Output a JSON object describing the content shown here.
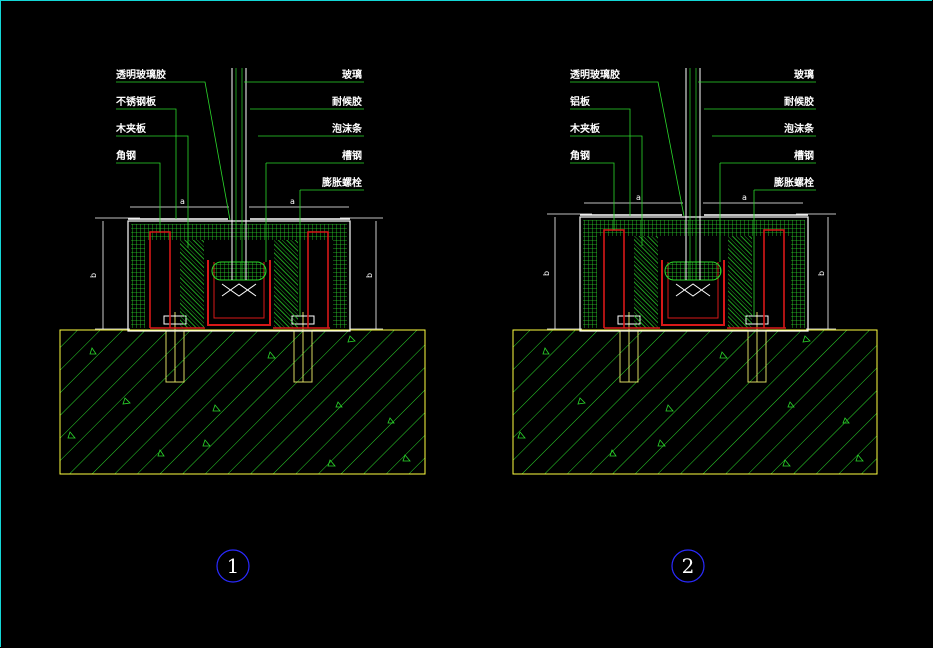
{
  "details": [
    {
      "number": "1",
      "labels_left": [
        "透明玻璃胶",
        "不锈钢板",
        "木夹板",
        "角钢"
      ],
      "labels_right": [
        "玻璃",
        "耐候胶",
        "泡沫条",
        "槽钢",
        "膨胀螺栓"
      ],
      "dims": {
        "a_left": "a",
        "a_right": "a",
        "b_left": "b",
        "b_right": "b"
      }
    },
    {
      "number": "2",
      "labels_left": [
        "透明玻璃胶",
        "铝板",
        "木夹板",
        "角钢"
      ],
      "labels_right": [
        "玻璃",
        "耐候胶",
        "泡沫条",
        "槽钢",
        "膨胀螺栓"
      ],
      "dims": {
        "a_left": "a",
        "a_right": "a",
        "b_left": "b",
        "b_right": "b"
      }
    }
  ],
  "colors": {
    "background": "#000000",
    "frame": "#14d6d6",
    "line_green": "#1fd81f",
    "section_hatch": "#2bd82b",
    "red": "#d81818",
    "white": "#ffffff",
    "yellow": "#ffff40",
    "circle_blue": "#2a2aff"
  }
}
